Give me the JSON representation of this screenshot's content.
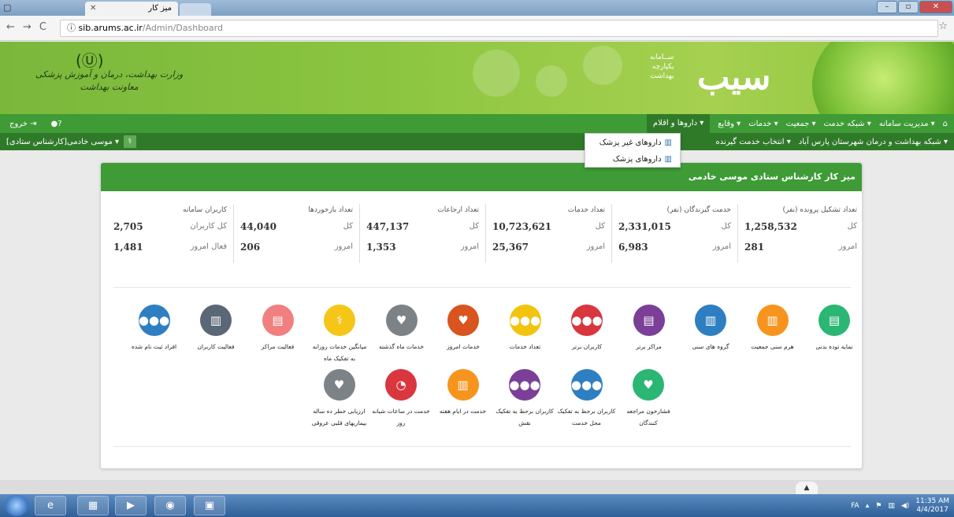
{
  "browser": {
    "tab_title": "میز کار",
    "url_host": "sib.arums.ac.ir",
    "url_path": "/Admin/Dashboard"
  },
  "banner": {
    "logo": "سیب",
    "logo_sub": [
      "ســامانه",
      "یکپارچه",
      "بهداشت"
    ],
    "ministry_line1": "وزارت بهداشت، درمان و آموزش پزشکی",
    "ministry_line2": "معاونت بهداشت"
  },
  "menu": {
    "home_items": [
      "مدیریت سامانه ▾",
      "شبکه خدمت ▾",
      "جمعیت ▾",
      "خدمات ▾",
      "وقایع ▾"
    ],
    "active": "داروها و اقلام ▾",
    "logout": "خروج",
    "help_icon": "question-icon"
  },
  "submenu": {
    "network": "شبکه بهداشت و درمان شهرستان پارس آباد ▾",
    "select_client": "انتخاب خدمت گیرنده ▾",
    "user": "موسی خادمی[کارشناس ستادی] ▾"
  },
  "dropdown": {
    "options": [
      "داروهای غیر پزشک",
      "داروهای پزشک"
    ]
  },
  "card": {
    "title": "میز کار کارشناس ستادی موسی خادمی"
  },
  "stats": [
    {
      "title": "تعداد تشکیل پرونده (نفر)",
      "row1_label": "کل",
      "row1_value": "1,258,532",
      "row2_label": "امروز",
      "row2_value": "281"
    },
    {
      "title": "خدمت گیرندگان (نفر)",
      "row1_label": "کل",
      "row1_value": "2,331,015",
      "row2_label": "امروز",
      "row2_value": "6,983"
    },
    {
      "title": "تعداد خدمات",
      "row1_label": "کل",
      "row1_value": "10,723,621",
      "row2_label": "امروز",
      "row2_value": "25,367"
    },
    {
      "title": "تعداد ارجاعات",
      "row1_label": "کل",
      "row1_value": "447,137",
      "row2_label": "امروز",
      "row2_value": "1,353"
    },
    {
      "title": "تعداد بازخوردها",
      "row1_label": "کل",
      "row1_value": "44,040",
      "row2_label": "امروز",
      "row2_value": "206"
    },
    {
      "title": "کاربران سامانه",
      "row1_label": "کل کاربران",
      "row1_value": "2,705",
      "row2_label": "فعال امروز",
      "row2_value": "1,481"
    }
  ],
  "tiles_row1": [
    {
      "label": "نمایه توده بدنی",
      "color": "#2bb673",
      "glyph": "▤"
    },
    {
      "label": "هرم سنی جمعیت",
      "color": "#f7941d",
      "glyph": "▥"
    },
    {
      "label": "گروه های سنی",
      "color": "#2e7fc1",
      "glyph": "▥"
    },
    {
      "label": "مراکز برتر",
      "color": "#7b3f98",
      "glyph": "▤"
    },
    {
      "label": "کاربران برتر",
      "color": "#d9363e",
      "glyph": "●●●"
    },
    {
      "label": "تعداد خدمات",
      "color": "#f2c40f",
      "glyph": "●●●"
    },
    {
      "label": "خدمات امروز",
      "color": "#d9541e",
      "glyph": "♥"
    },
    {
      "label": "خدمات ماه گذشته",
      "color": "#7d8287",
      "glyph": "♥"
    },
    {
      "label": "میانگین خدمات روزانه به تفکیک ماه",
      "color": "#f5c518",
      "glyph": "⚕"
    },
    {
      "label": "فعالیت مراکز",
      "color": "#f08080",
      "glyph": "▤"
    },
    {
      "label": "فعالیت کاربران",
      "color": "#5a6776",
      "glyph": "▥"
    },
    {
      "label": "افراد ثبت نام شده",
      "color": "#2e7fc1",
      "glyph": "●●●"
    }
  ],
  "tiles_row2": [
    {
      "label": "فشارخون مراجعه کنندگان",
      "color": "#2bb673",
      "glyph": "♥"
    },
    {
      "label": "کاربران برحظ به تفکیک محل خدمت",
      "color": "#2e7fc1",
      "glyph": "●●●"
    },
    {
      "label": "کاربران برحظ به تفکیک نقش",
      "color": "#7b3f98",
      "glyph": "●●●"
    },
    {
      "label": "خدمت در ایام هفته",
      "color": "#f7941d",
      "glyph": "▥"
    },
    {
      "label": "خدمت در ساعات شبانه روز",
      "color": "#d9363e",
      "glyph": "◔"
    },
    {
      "label": "ارزیابی خطر ده ساله بیماریهای قلبی عروقی",
      "color": "#7d8287",
      "glyph": "♥"
    }
  ],
  "taskbar": {
    "lang": "FA",
    "time": "11:35 AM",
    "date": "4/4/2017"
  }
}
